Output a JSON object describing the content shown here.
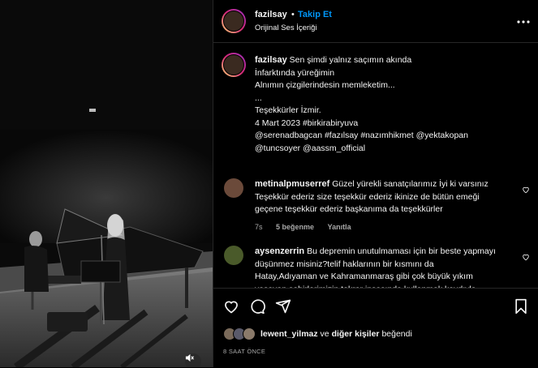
{
  "post": {
    "username": "fazilsay",
    "separator": "•",
    "follow_label": "Takip Et",
    "audio_label": "Orijinal Ses İçeriği"
  },
  "caption": {
    "username": "fazilsay",
    "lines": [
      "Sen şimdi yalnız saçımın akında",
      "İnfarktında yüreğimin",
      "Alnımın çizgilerindesin memleketim...",
      "...",
      "Teşekkürler İzmir.",
      "4 Mart 2023 #birkirabiryuva",
      "@serenadbagcan #fazılsay #nazımhikmet @yektakopan",
      "@tuncsoyer @aassm_official"
    ]
  },
  "comments": [
    {
      "username": "metinalpmuserref",
      "text": "Güzel yürekli sanatçılarımız İyi ki varsınız Teşekkür ederiz size teşekkür ederiz ikinize de bütün emeği geçene teşekkür ederiz başkanıma da teşekkürler",
      "age": "7s",
      "likes": "5 beğenme",
      "reply": "Yanıtla",
      "avatar_color": "#6b4a3a"
    },
    {
      "username": "aysenzerrin",
      "text": "Bu depremin unutulmaması için bir beste yapmayı düşünmez misiniz?telif haklarının bir kısmını da Hatay,Adıyaman ve Kahramanmaraş gibi çok büyük yıkım yaşayan şehirlerimizin tekrar inşasında kullanmak kaydıyla saygı",
      "avatar_color": "#4a5a2a"
    }
  ],
  "likes": {
    "first_user": "lewent_yilmaz",
    "connector": "ve",
    "others": "diğer kişiler",
    "suffix": "beğendi"
  },
  "timestamp": "8 SAAT ÖNCE",
  "icons": [
    "more-icon",
    "heart-icon",
    "comment-icon",
    "share-icon",
    "bookmark-icon",
    "mute-icon"
  ]
}
